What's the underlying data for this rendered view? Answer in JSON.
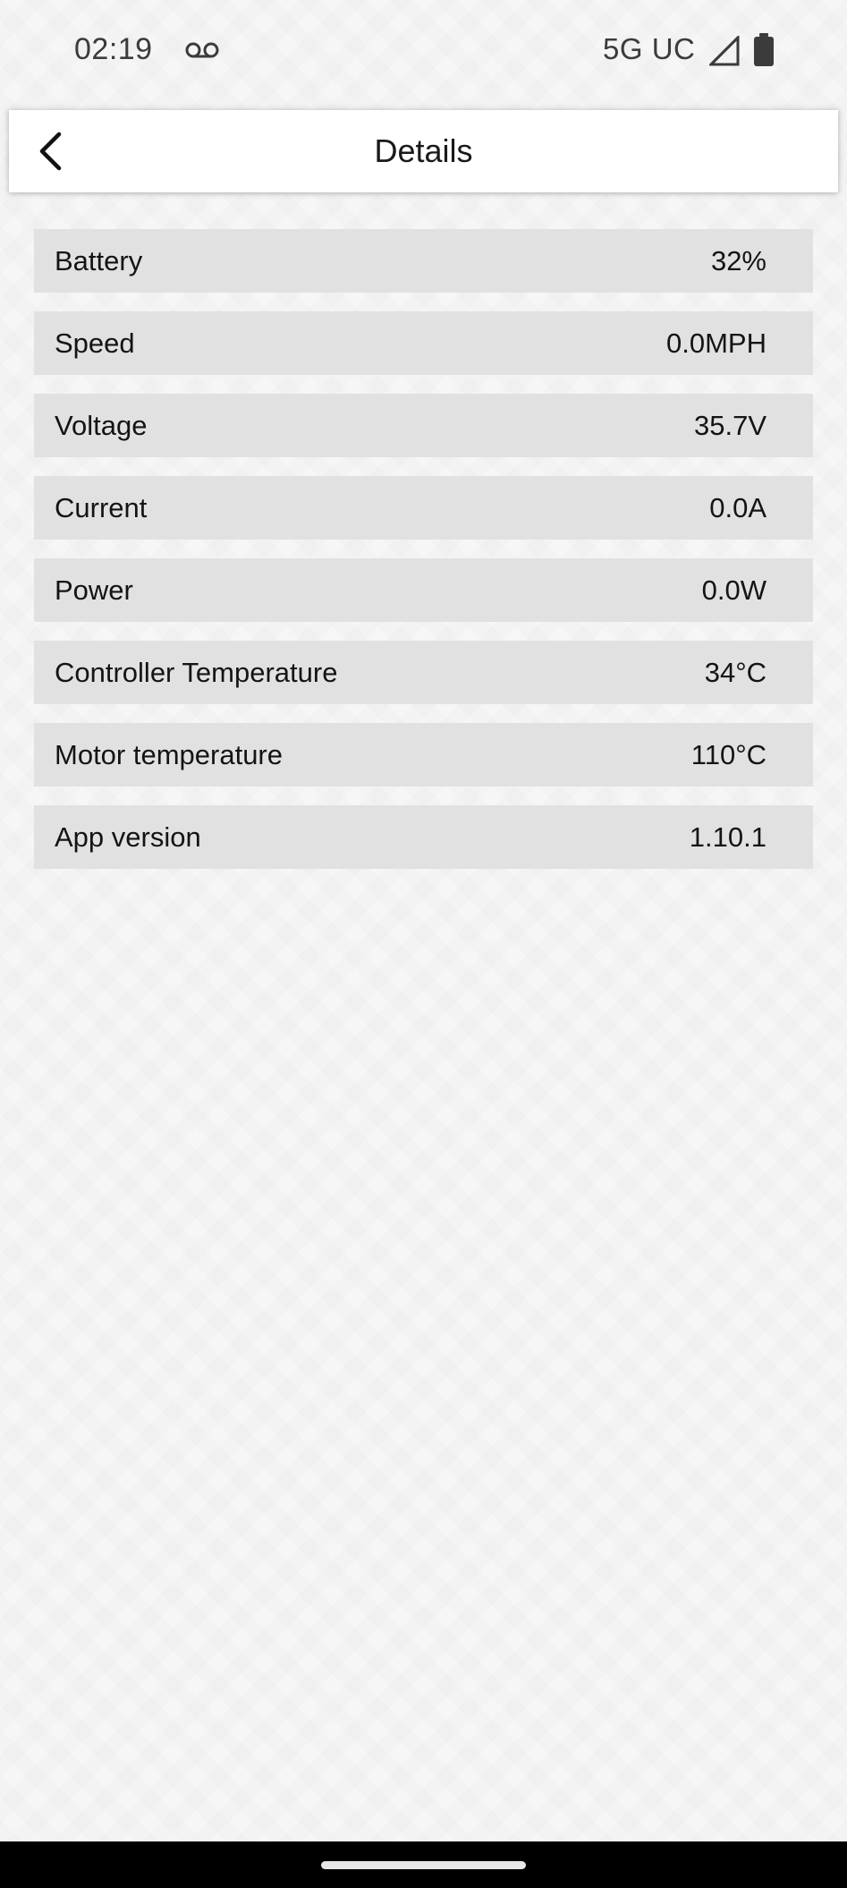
{
  "status_bar": {
    "time": "02:19",
    "network": "5G UC"
  },
  "header": {
    "title": "Details"
  },
  "details": [
    {
      "label": "Battery",
      "value": "32%"
    },
    {
      "label": "Speed",
      "value": "0.0MPH"
    },
    {
      "label": "Voltage",
      "value": "35.7V"
    },
    {
      "label": "Current",
      "value": "0.0A"
    },
    {
      "label": "Power",
      "value": "0.0W"
    },
    {
      "label": "Controller Temperature",
      "value": "34°C"
    },
    {
      "label": "Motor temperature",
      "value": "110°C"
    },
    {
      "label": "App version",
      "value": "1.10.1"
    }
  ],
  "colors": {
    "background": "#f6f6f6",
    "row_background": "#e1e1e1",
    "header_background": "#ffffff",
    "nav_bar": "#000000"
  },
  "icons": {
    "voicemail": "voicemail-icon",
    "signal": "signal-icon",
    "battery": "battery-icon",
    "back": "back-arrow-icon",
    "home": "home-indicator"
  }
}
